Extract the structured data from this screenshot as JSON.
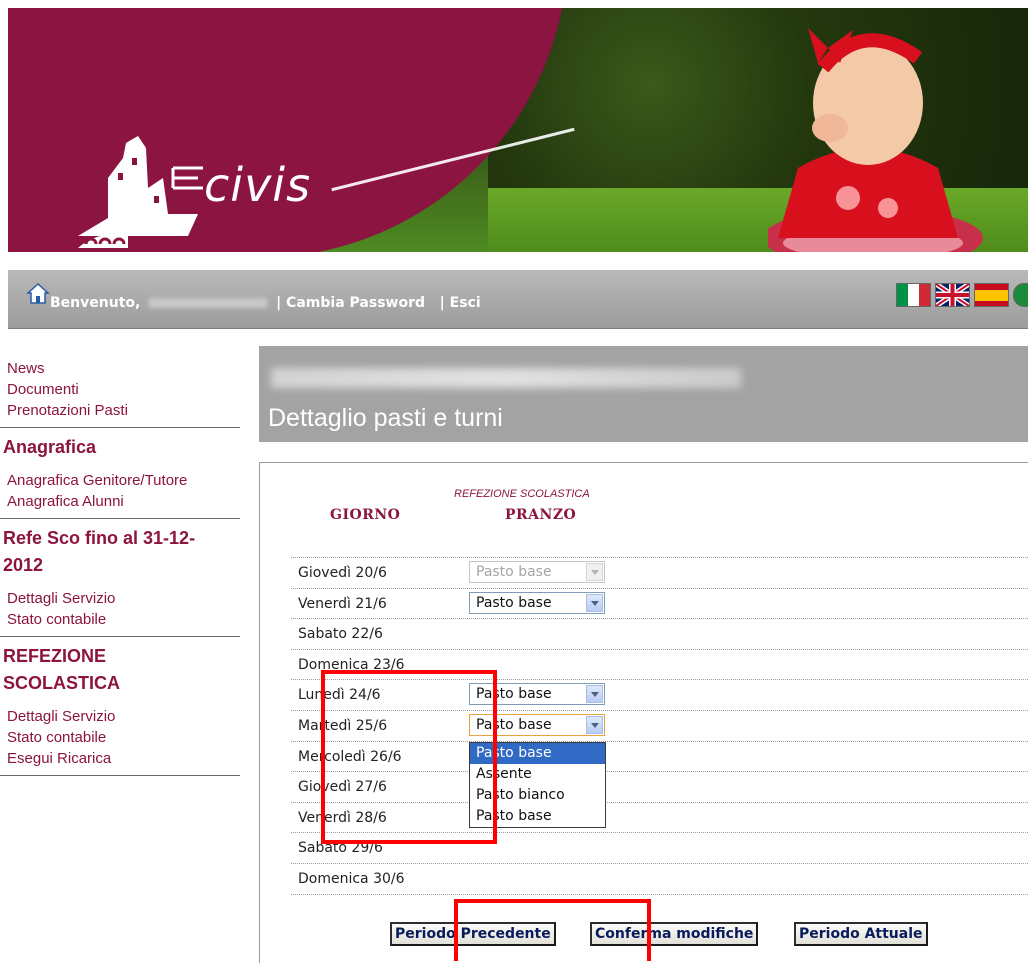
{
  "banner": {
    "logo_text": "civis"
  },
  "toolbar": {
    "welcome_label": "Benvenuto,",
    "separator1": "|",
    "change_password": "Cambia Password",
    "separator2": "|",
    "logout": "Esci",
    "flags": [
      "italian-flag-icon",
      "uk-flag-icon",
      "spanish-flag-icon"
    ]
  },
  "sidebar": {
    "links_top": [
      "News",
      "Documenti",
      "Prenotazioni Pasti"
    ],
    "section1": {
      "heading": "Anagrafica",
      "links": [
        "Anagrafica Genitore/Tutore",
        "Anagrafica Alunni"
      ]
    },
    "section2": {
      "heading_line1": "Refe Sco fino al 31-12-",
      "heading_line2": "2012",
      "links": [
        "Dettagli Servizio",
        "Stato contabile"
      ]
    },
    "section3": {
      "heading_line1": "REFEZIONE",
      "heading_line2": "SCOLASTICA",
      "links": [
        "Dettagli Servizio",
        "Stato contabile",
        "Esegui Ricarica"
      ]
    }
  },
  "main": {
    "page_title": "Dettaglio pasti e turni",
    "table": {
      "col_day": "GIORNO",
      "col_service": "REFEZIONE SCOLASTICA",
      "col_meal": "PRANZO",
      "rows": [
        {
          "day": "Giovedì 20/6",
          "meal": "Pasto base",
          "state": "disabled"
        },
        {
          "day": "Venerdì 21/6",
          "meal": "Pasto base",
          "state": "enabled"
        },
        {
          "day": "Sabato 22/6",
          "meal": "",
          "state": "none"
        },
        {
          "day": "Domenica 23/6",
          "meal": "",
          "state": "none"
        },
        {
          "day": "Lunedì 24/6",
          "meal": "Pasto base",
          "state": "enabled"
        },
        {
          "day": "Martedì 25/6",
          "meal": "Pasto base",
          "state": "open"
        },
        {
          "day": "Mercoledì 26/6",
          "meal": "",
          "state": "none"
        },
        {
          "day": "Giovedì 27/6",
          "meal": "",
          "state": "none"
        },
        {
          "day": "Venerdì 28/6",
          "meal": "",
          "state": "none"
        },
        {
          "day": "Sabato 29/6",
          "meal": "",
          "state": "none"
        },
        {
          "day": "Domenica 30/6",
          "meal": "",
          "state": "none"
        }
      ]
    },
    "dropdown_options": [
      "Pasto base",
      "Assente",
      "Pasto bianco",
      "Pasto base"
    ],
    "buttons": {
      "prev": "Periodo Precedente",
      "confirm": "Conferma modifiche",
      "current": "Periodo Attuale"
    }
  },
  "colors": {
    "brand": "#8c1440",
    "toolbar": "#a3a3a3",
    "highlight": "#ff0000",
    "selection": "#316ac5"
  }
}
